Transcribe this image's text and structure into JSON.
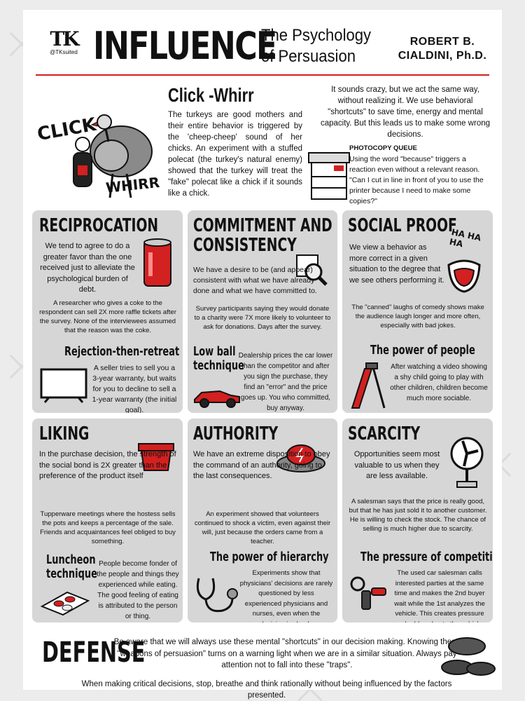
{
  "header": {
    "logo_mark": "TK",
    "logo_handle": "@TKsuited",
    "title": "INFLUENCE",
    "subtitle_line1": "The Psychology",
    "subtitle_line2": "of Persuasion",
    "author_line1": "ROBERT B.",
    "author_line2": "CIALDINI, Ph.D."
  },
  "intro": {
    "click_label": "CLICK",
    "whirr_label": "WHIRR",
    "title": "Click -Whirr",
    "body": "The turkeys are good mothers and their entire behavior is triggered by the 'cheep-cheep' sound of her chicks. An experiment with a stuffed polecat (the turkey's natural enemy) showed that the turkey will treat the \"fake\" polecat like a chick if it sounds like a chick.",
    "right_text": "It sounds crazy, but we act the same way, without realizing it. We use behavioral \"shortcuts\" to save time, energy and mental capacity. But this leads us to make some wrong decisions.",
    "photocopy_title": "PHOTOCOPY QUEUE",
    "photocopy_body": "Using the word \"because\" triggers a reaction even without a relevant reason. \"Can I cut in line in front of you to use the printer because I need to make some copies?\""
  },
  "reciprocation": {
    "title": "RECIPROCATION",
    "body": "We tend to agree to do a greater favor than the one received just to alleviate the psychological burden of debt.",
    "small": "A researcher who gives a coke to the respondent can sell 2X more raffle tickets after the survey. None of the interviewees assumed that the reason was the coke.",
    "sub_title": "Rejection-then-retreat",
    "sub_body": "A seller tries to sell you a 3-year warranty, but waits for you to decline to sell a 1-year warranty (the initial goal)."
  },
  "commitment": {
    "title_line1": "COMMITMENT AND",
    "title_line2": "CONSISTENCY",
    "body": "We have a desire to be (and appear) consistent with what we have already done and what we have committed to.",
    "small": "Survey participants saying they would donate to a charity were 7X more likely to volunteer to ask for donations. Days after the survey.",
    "sub_title_line1": "Low ball",
    "sub_title_line2": "technique",
    "sub_body": "Dealership prices the car lower than the competitor and after you sign the purchase, they find an \"error\" and the price goes up. You who committed, buy anyway."
  },
  "social_proof": {
    "title": "SOCIAL PROOF",
    "laugh": "HA HA HA",
    "body": "We view a behavior as more correct in a given situation to the degree that we see others performing it.",
    "small": "The \"canned\" laughs of comedy shows make the audience laugh longer and more often, especially with bad jokes.",
    "sub_title": "The power of people",
    "sub_body": "After watching a video showing a shy child going to play with other children, children become much more sociable."
  },
  "liking": {
    "title": "LIKING",
    "body": "In the purchase decision, the strength of the social bond is 2X greater than the preference of the product itself",
    "small": "Tupperware meetings where the hostess sells the pots and keeps a percentage of the sale. Friends and acquaintances feel obliged to buy something.",
    "sub_title_line1": "Luncheon",
    "sub_title_line2": "technique",
    "sub_body": "People become fonder of the people and things they experienced while eating. The good feeling of eating is attributed to the person or thing."
  },
  "authority": {
    "title": "AUTHORITY",
    "body": "We have an extreme disposition to obey the command of an authority, going to the last consequences.",
    "small": "An experiment showed that volunteers continued to shock a victim, even against their will, just because the orders came from a teacher.",
    "sub_title": "The power of hierarchy",
    "sub_body": "Experiments show that physicians' decisions are rarely questioned by less experienced physicians and nurses, even when the decision is clearly inappropriate."
  },
  "scarcity": {
    "title": "SCARCITY",
    "body": "Opportunities seem most valuable to us when they are less available.",
    "small": "A salesman says that the price is really good, but that he has just sold it to another customer. He is willing to check the stock. The chance of selling is much higher due to scarcity.",
    "sub_title": "The pressure of competition",
    "sub_body": "The used car salesman calls interested parties at the same time and makes the 2nd buyer wait while the 1st analyzes the vehicle. This creates pressure and adds value to the vehicle."
  },
  "defense": {
    "title": "DEFENSE",
    "body": "Be aware that we will always use these mental \"shortcuts\" in our decision making. Knowing these \"weapons of persuasion\" turns on a warning light when we are in a similar situation. Always pay attention not to fall into these \"traps\".",
    "last": "When making critical decisions, stop, breathe and think rationally without being influenced by the factors presented."
  },
  "colors": {
    "accent": "#d32020",
    "panel": "#d6d6d6",
    "ink": "#111111"
  }
}
